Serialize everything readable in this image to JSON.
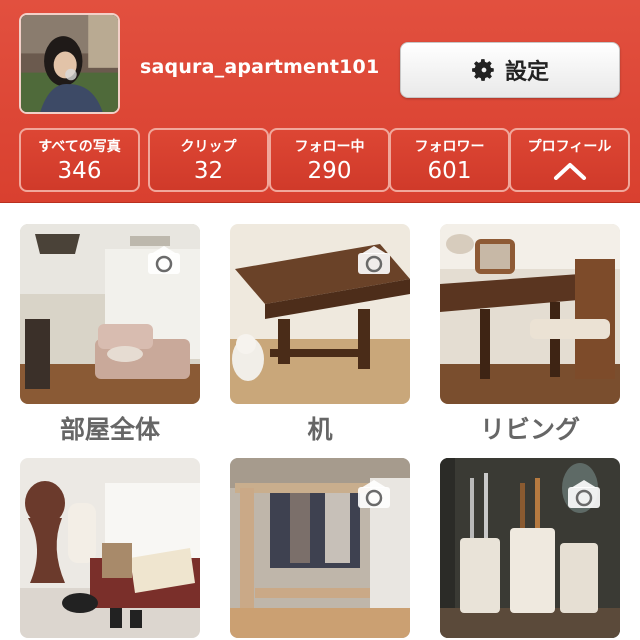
{
  "profile": {
    "username": "saqura_apartment101",
    "settings_label": "設定"
  },
  "stats": [
    {
      "label": "すべての写真",
      "value": "346"
    },
    {
      "label": "クリップ",
      "value": "32"
    },
    {
      "label": "フォロー中",
      "value": "290"
    },
    {
      "label": "フォロワー",
      "value": "601"
    },
    {
      "label": "プロフィール",
      "icon": "chevron-up-icon"
    }
  ],
  "albums": [
    {
      "caption": "部屋全体",
      "icon": "camera-icon"
    },
    {
      "caption": "机",
      "icon": "camera-icon"
    },
    {
      "caption": "リビング",
      "icon": ""
    },
    {
      "caption": "",
      "icon": ""
    },
    {
      "caption": "",
      "icon": "camera-icon"
    },
    {
      "caption": "",
      "icon": "camera-icon"
    }
  ],
  "colors": {
    "header_red": "#dd4634",
    "caption_gray": "#666666"
  }
}
